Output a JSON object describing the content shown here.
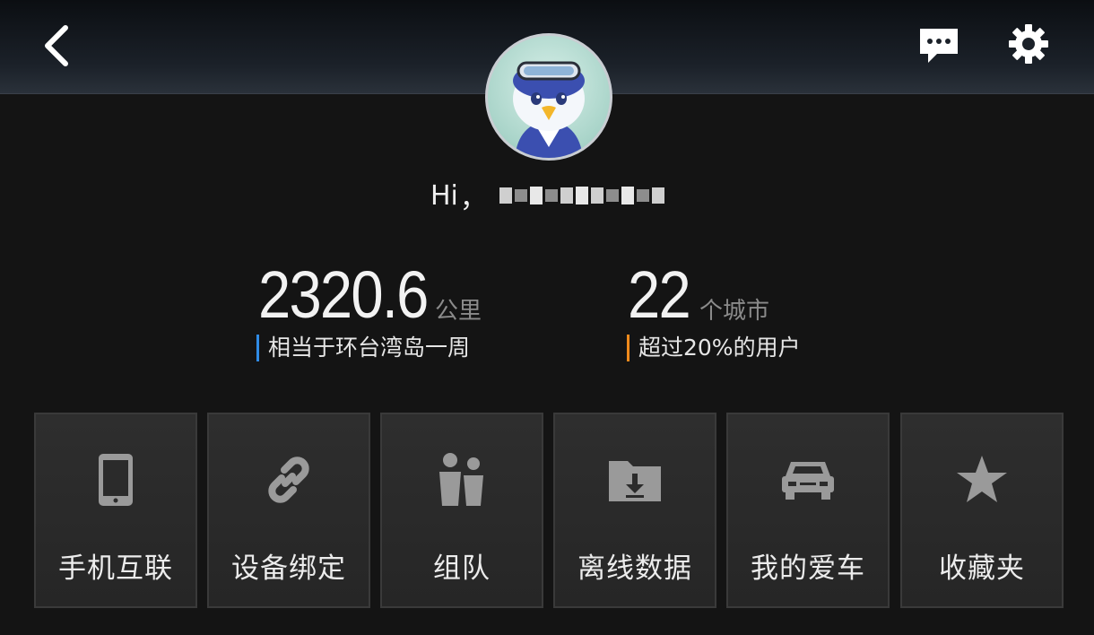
{
  "header": {
    "back_icon": "chevron-left-icon",
    "messages_icon": "chat-bubble-icon",
    "settings_icon": "gear-icon"
  },
  "profile": {
    "greeting": "Hi",
    "comma": "，"
  },
  "stats": {
    "distance": {
      "value": "2320.6",
      "unit": "公里",
      "description": "相当于环台湾岛一周",
      "accent": "#2f8be6"
    },
    "cities": {
      "value": "22",
      "unit": "个城市",
      "description": "超过20%的用户",
      "accent": "#f08a1c"
    }
  },
  "menu": {
    "items": [
      {
        "label": "手机互联",
        "icon": "smartphone-icon"
      },
      {
        "label": "设备绑定",
        "icon": "link-icon"
      },
      {
        "label": "组队",
        "icon": "team-icon"
      },
      {
        "label": "离线数据",
        "icon": "folder-download-icon"
      },
      {
        "label": "我的爱车",
        "icon": "car-icon"
      },
      {
        "label": "收藏夹",
        "icon": "star-icon"
      }
    ]
  }
}
